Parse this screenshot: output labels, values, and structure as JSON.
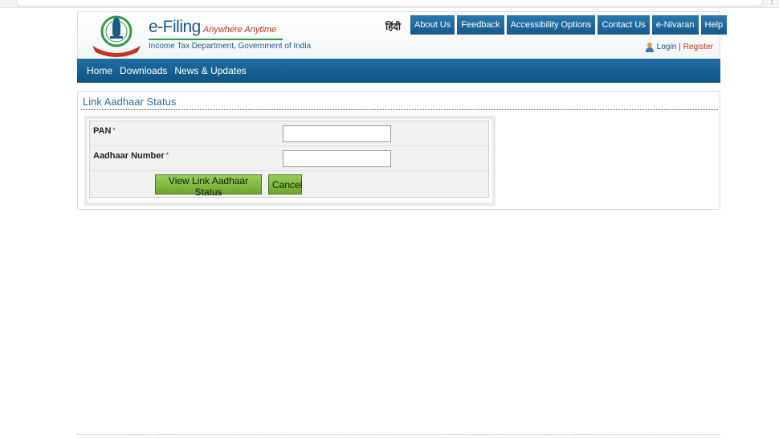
{
  "header": {
    "brand_name": "e-Filing",
    "tagline": "Anywhere Anytime",
    "department": "Income Tax Department, Government of India",
    "language_link": "हिंदी",
    "nav_items": [
      "About Us",
      "Feedback",
      "Accessibility Options",
      "Contact Us",
      "e-Nivaran",
      "Help"
    ],
    "login_label": "Login",
    "separator": "|",
    "register_label": "Register",
    "colors": {
      "nav_blue": "#16598c",
      "brand_red": "#c8321e",
      "brand_green": "#2f9a45"
    }
  },
  "main_nav": {
    "items": [
      "Home",
      "Downloads",
      "News & Updates"
    ]
  },
  "form": {
    "title": "Link Aadhaar Status",
    "fields": [
      {
        "label": "PAN",
        "required_mark": "*",
        "value": ""
      },
      {
        "label": "Aadhaar Number",
        "required_mark": "*",
        "value": ""
      }
    ],
    "submit_label": "View Link Aadhaar Status",
    "cancel_label": "Cancel",
    "button_color": "#7cb342"
  },
  "icons": [
    "government-emblem-icon",
    "user-icon",
    "browser-menu-icon"
  ]
}
